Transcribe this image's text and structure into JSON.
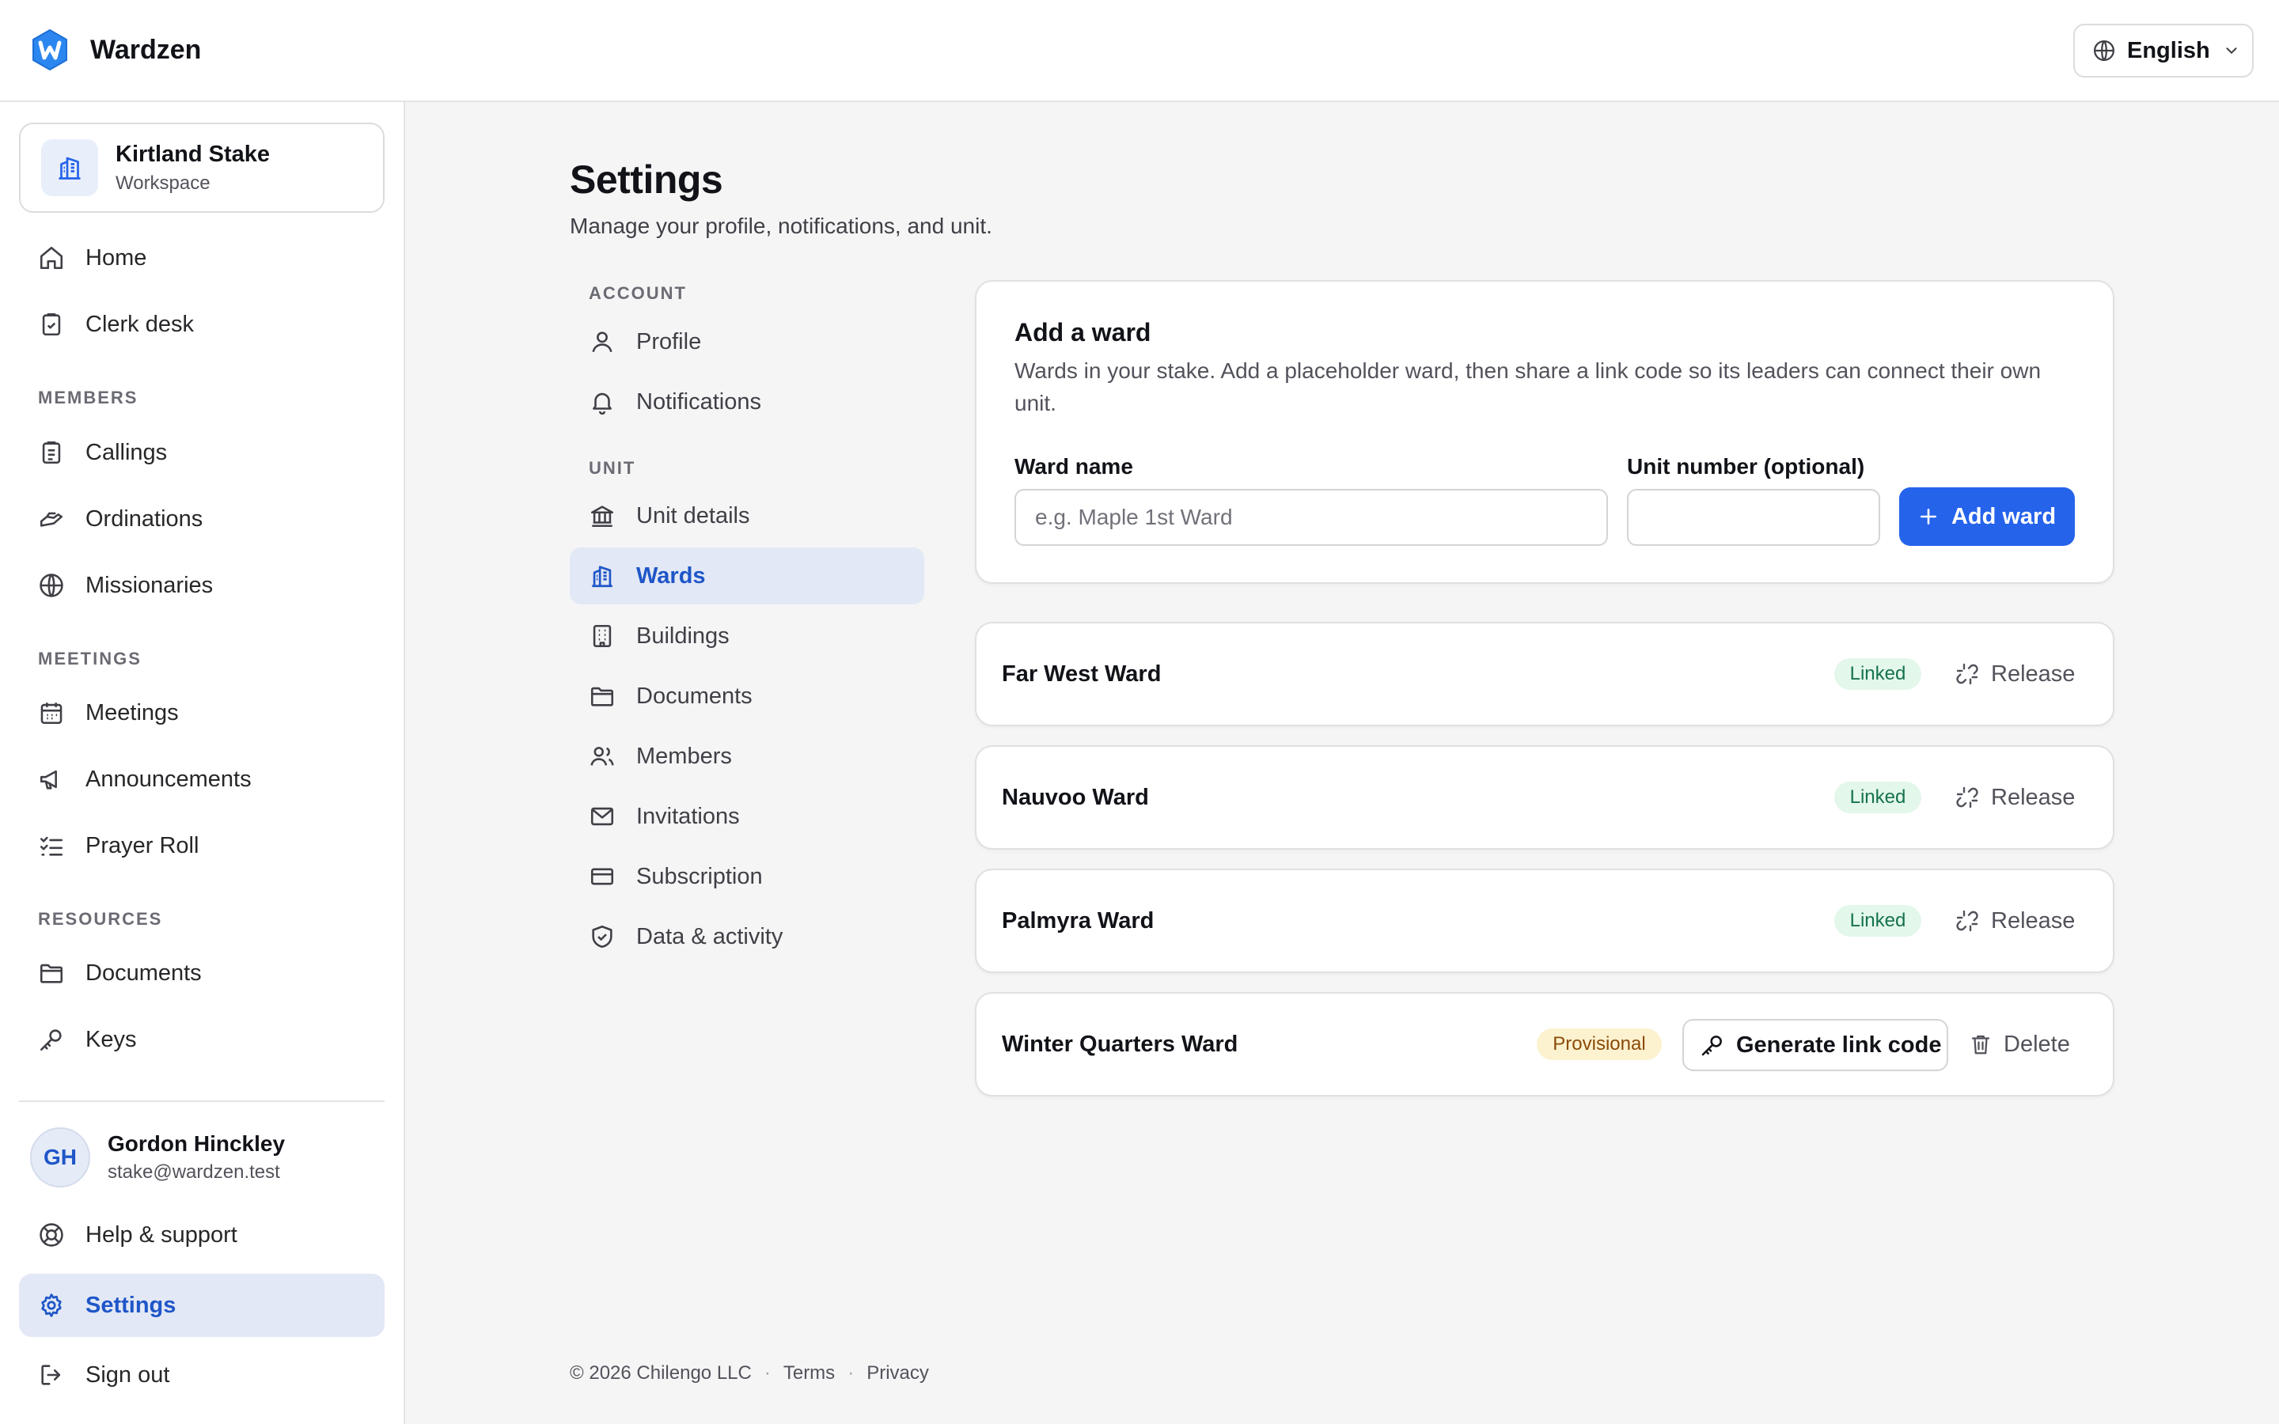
{
  "app": {
    "name": "Wardzen",
    "logo_letter": "W"
  },
  "header": {
    "language": "English"
  },
  "workspace": {
    "name": "Kirtland Stake",
    "type": "Workspace"
  },
  "sidebar": {
    "top_items": [
      {
        "label": "Home",
        "icon": "home-icon"
      },
      {
        "label": "Clerk desk",
        "icon": "clipboard-check-icon"
      }
    ],
    "sections": [
      {
        "title": "MEMBERS",
        "items": [
          {
            "label": "Callings",
            "icon": "clipboard-list-icon"
          },
          {
            "label": "Ordinations",
            "icon": "hands-icon"
          },
          {
            "label": "Missionaries",
            "icon": "globe-icon"
          }
        ]
      },
      {
        "title": "MEETINGS",
        "items": [
          {
            "label": "Meetings",
            "icon": "calendar-icon"
          },
          {
            "label": "Announcements",
            "icon": "megaphone-icon"
          },
          {
            "label": "Prayer Roll",
            "icon": "checklist-icon"
          }
        ]
      },
      {
        "title": "RESOURCES",
        "items": [
          {
            "label": "Documents",
            "icon": "folder-icon"
          },
          {
            "label": "Keys",
            "icon": "key-icon"
          }
        ]
      }
    ],
    "user": {
      "initials": "GH",
      "name": "Gordon Hinckley",
      "email": "stake@wardzen.test"
    },
    "bottom_items": [
      {
        "label": "Help & support",
        "icon": "lifebuoy-icon"
      },
      {
        "label": "Settings",
        "icon": "gear-icon",
        "active": true
      },
      {
        "label": "Sign out",
        "icon": "sign-out-icon"
      }
    ]
  },
  "page": {
    "title": "Settings",
    "subtitle": "Manage your profile, notifications, and unit."
  },
  "settings_nav": {
    "account_title": "ACCOUNT",
    "account_items": [
      {
        "label": "Profile",
        "icon": "user-icon"
      },
      {
        "label": "Notifications",
        "icon": "bell-icon"
      }
    ],
    "unit_title": "UNIT",
    "unit_items": [
      {
        "label": "Unit details",
        "icon": "landmark-icon"
      },
      {
        "label": "Wards",
        "icon": "building-icon",
        "active": true
      },
      {
        "label": "Buildings",
        "icon": "office-building-icon"
      },
      {
        "label": "Documents",
        "icon": "folder-icon"
      },
      {
        "label": "Members",
        "icon": "users-icon"
      },
      {
        "label": "Invitations",
        "icon": "mail-icon"
      },
      {
        "label": "Subscription",
        "icon": "credit-card-icon"
      },
      {
        "label": "Data & activity",
        "icon": "shield-check-icon"
      }
    ]
  },
  "add_ward": {
    "title": "Add a ward",
    "description": "Wards in your stake. Add a placeholder ward, then share a link code so its leaders can connect their own unit.",
    "ward_name_label": "Ward name",
    "ward_name_placeholder": "e.g. Maple 1st Ward",
    "ward_name_value": "",
    "unit_number_label": "Unit number (optional)",
    "unit_number_value": "",
    "button_label": "Add ward"
  },
  "wards": [
    {
      "name": "Far West Ward",
      "status": "Linked",
      "action": "Release"
    },
    {
      "name": "Nauvoo Ward",
      "status": "Linked",
      "action": "Release"
    },
    {
      "name": "Palmyra Ward",
      "status": "Linked",
      "action": "Release"
    },
    {
      "name": "Winter Quarters Ward",
      "status": "Provisional",
      "primary_action": "Generate link code",
      "action": "Delete"
    }
  ],
  "footer": {
    "copyright": "© 2026 Chilengo LLC",
    "terms": "Terms",
    "privacy": "Privacy",
    "separator": "·"
  },
  "colors": {
    "accent": "#2563eb",
    "active_bg": "#e2e8f5",
    "linked_bg": "#e3f7ea",
    "linked_text": "#16734a",
    "provisional_bg": "#fdf2cf",
    "provisional_text": "#8a4b08"
  }
}
